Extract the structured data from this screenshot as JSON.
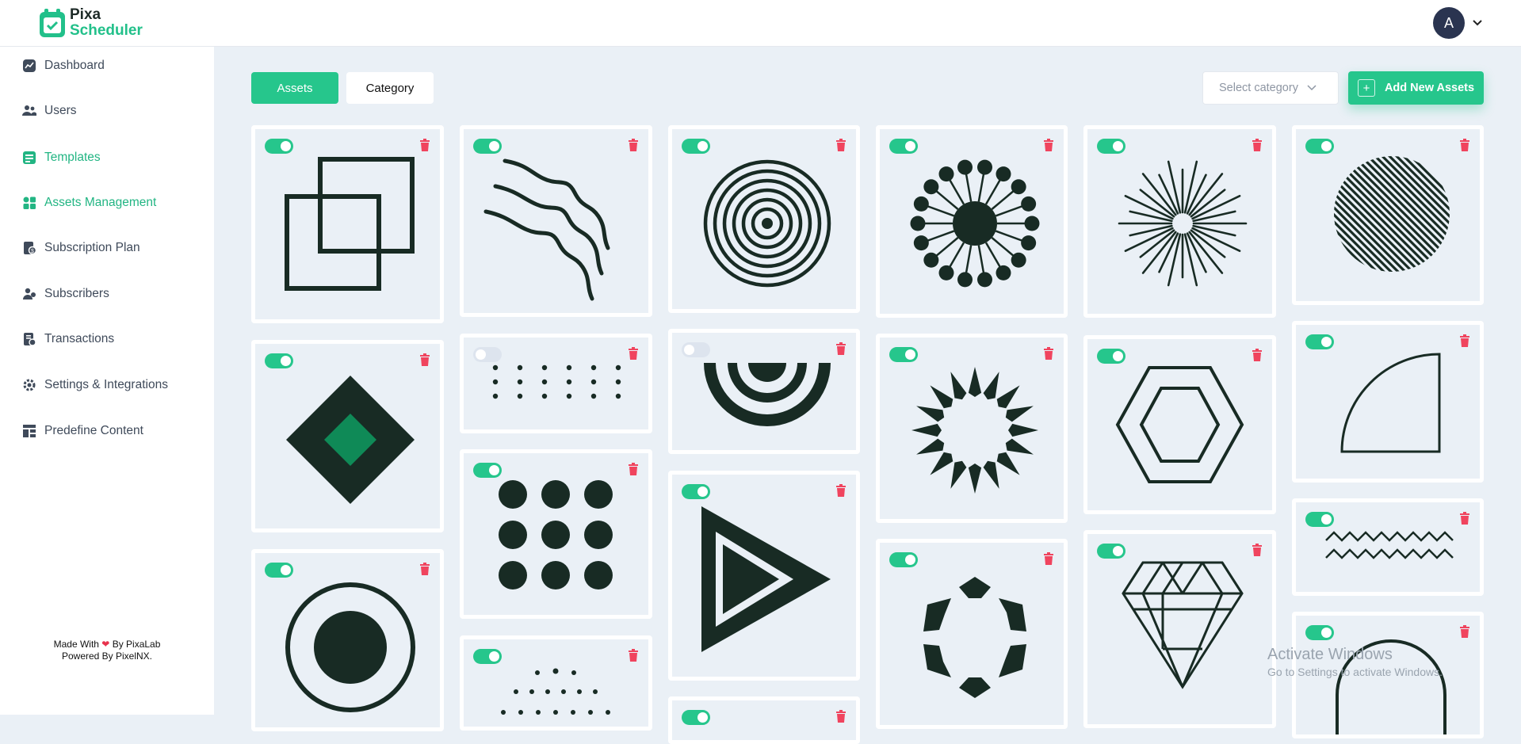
{
  "app": {
    "logo_line1": "Pixa",
    "logo_line2": "Scheduler"
  },
  "user": {
    "avatar_letter": "A"
  },
  "sidebar": {
    "items": [
      {
        "label": "Dashboard",
        "icon": "chart-icon"
      },
      {
        "label": "Users",
        "icon": "users-icon"
      },
      {
        "label": "Templates",
        "icon": "template-icon"
      },
      {
        "label": "Assets Management",
        "icon": "assets-icon"
      },
      {
        "label": "Subscription Plan",
        "icon": "subscription-icon"
      },
      {
        "label": "Subscribers",
        "icon": "subscribers-icon"
      },
      {
        "label": "Transactions",
        "icon": "transactions-icon"
      },
      {
        "label": "Settings & Integrations",
        "icon": "settings-icon"
      },
      {
        "label": "Predefine Content",
        "icon": "content-icon"
      }
    ],
    "active_index": 3,
    "footer_line1_pre": "Made With",
    "footer_line1_post": "By PixaLab",
    "footer_line2": "Powered By PixelNX."
  },
  "toolbar": {
    "assets_tab": "Assets",
    "category_tab": "Category",
    "select_placeholder": "Select category",
    "add_button": "Add New Assets"
  },
  "assets": [
    {
      "shape": "overlapping-squares",
      "enabled": true
    },
    {
      "shape": "wavy-lines",
      "enabled": true
    },
    {
      "shape": "concentric-circles",
      "enabled": true
    },
    {
      "shape": "dotted-sun",
      "enabled": true
    },
    {
      "shape": "sunburst-lines",
      "enabled": true
    },
    {
      "shape": "striped-circle",
      "enabled": true
    },
    {
      "shape": "diamond",
      "enabled": true
    },
    {
      "shape": "dot-grid",
      "enabled": false
    },
    {
      "shape": "half-rings",
      "enabled": false
    },
    {
      "shape": "spiky-ring",
      "enabled": true
    },
    {
      "shape": "hexagon-outline",
      "enabled": true
    },
    {
      "shape": "quarter-circle",
      "enabled": true
    },
    {
      "shape": "circle-in-ring",
      "enabled": true
    },
    {
      "shape": "nine-dots",
      "enabled": true
    },
    {
      "shape": "play-triangle",
      "enabled": true
    },
    {
      "shape": "hexagon-segments",
      "enabled": true
    },
    {
      "shape": "gem",
      "enabled": true
    },
    {
      "shape": "zigzag-lines",
      "enabled": true
    },
    {
      "shape": "dotted-arc",
      "enabled": true
    },
    {
      "shape": "arch",
      "enabled": true
    },
    {
      "shape": "partial-card",
      "enabled": true
    }
  ],
  "colors": {
    "accent": "#26c68c",
    "shape": "#182b24",
    "danger": "#f0445e",
    "background": "#eaf0f6"
  },
  "watermark": {
    "line1": "Activate Windows",
    "line2": "Go to Settings to activate Windows."
  }
}
